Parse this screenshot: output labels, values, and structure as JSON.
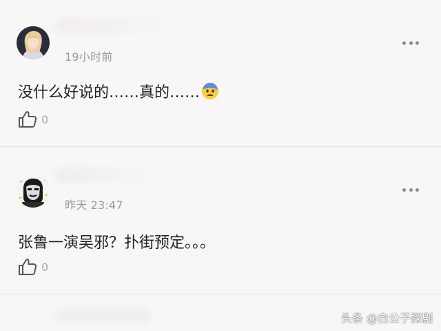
{
  "comments": [
    {
      "time": "19小时前",
      "text": "没什么好说的……真的……",
      "emoji": "anxious-face-with-sweat",
      "likes": "0"
    },
    {
      "time": "昨天 23:47",
      "text": "张鲁一演吴邪？扑街预定。。。",
      "likes": "0"
    }
  ],
  "watermark": "头条 @白公子探剧",
  "icons": {
    "more": "more-dots-icon",
    "like": "thumbs-up-icon"
  },
  "colors": {
    "background": "#f8f6f7",
    "text": "#222222",
    "meta": "#9a9a9a"
  }
}
